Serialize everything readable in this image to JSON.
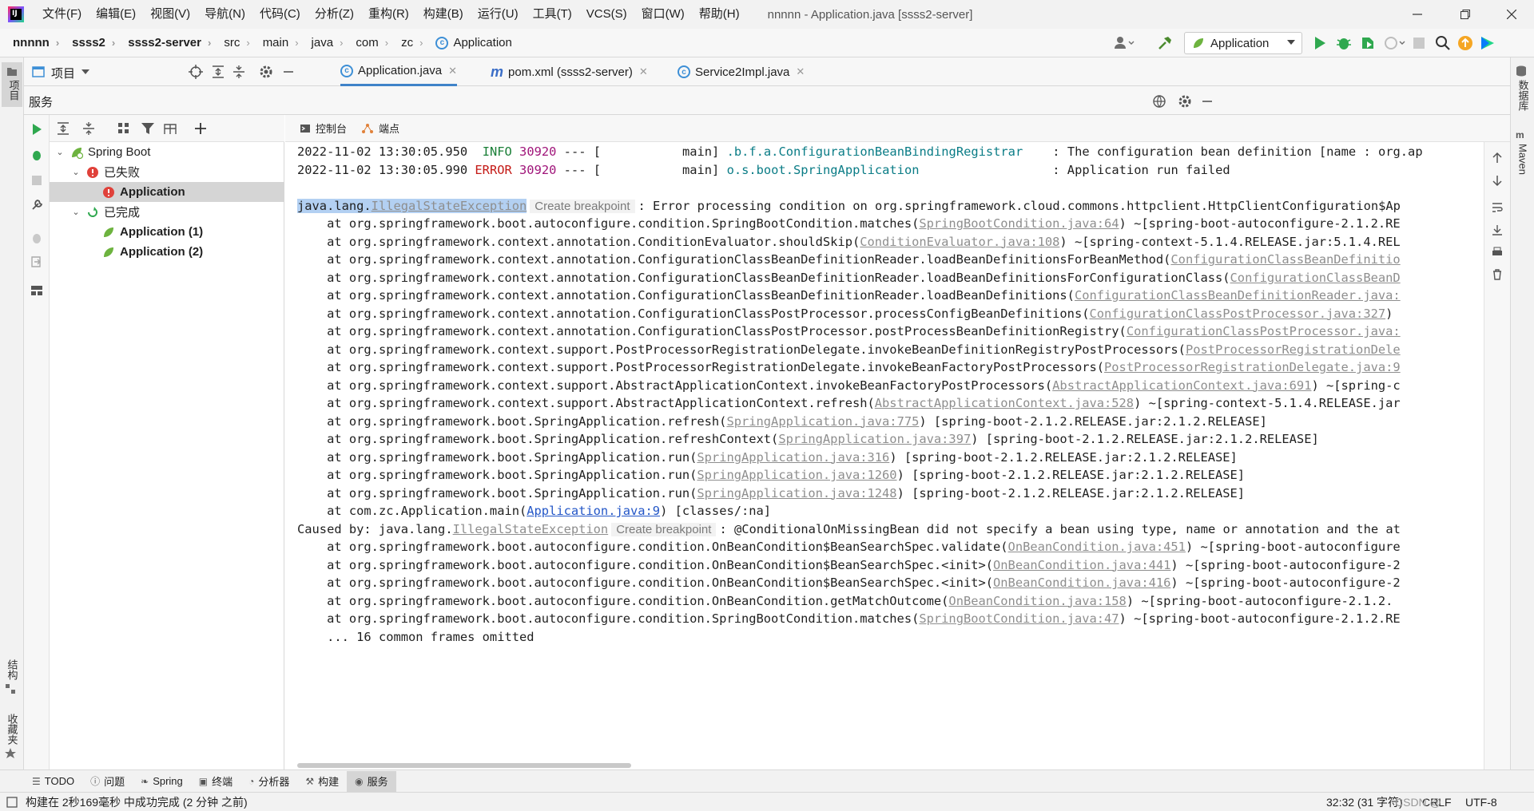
{
  "menu": {
    "items": [
      "文件(F)",
      "编辑(E)",
      "视图(V)",
      "导航(N)",
      "代码(C)",
      "分析(Z)",
      "重构(R)",
      "构建(B)",
      "运行(U)",
      "工具(T)",
      "VCS(S)",
      "窗口(W)",
      "帮助(H)"
    ],
    "window_title": "nnnnn - Application.java [ssss2-server]"
  },
  "breadcrumbs": [
    "nnnnn",
    "ssss2",
    "ssss2-server",
    "src",
    "main",
    "java",
    "com",
    "zc",
    "Application"
  ],
  "run_config": {
    "label": "Application"
  },
  "left_strip": {
    "project": "项目",
    "structure": "结构",
    "favorites": "收藏夹"
  },
  "right_strip": {
    "database": "数据库",
    "maven": "Maven"
  },
  "project_panel": {
    "label": "项目"
  },
  "editor_tabs": [
    {
      "label": "Application.java",
      "icon": "class-icon",
      "active": true
    },
    {
      "label": "pom.xml (ssss2-server)",
      "icon": "maven-icon",
      "active": false
    },
    {
      "label": "Service2Impl.java",
      "icon": "class-icon",
      "active": false
    }
  ],
  "services": {
    "title": "服务",
    "tree": {
      "root": "Spring Boot",
      "failed_group": "已失败",
      "failed_items": [
        "Application"
      ],
      "done_group": "已完成",
      "done_items": [
        "Application (1)",
        "Application (2)"
      ]
    },
    "console_tabs": [
      "控制台",
      "端点"
    ]
  },
  "console": {
    "log_lines": [
      {
        "ts": "2022-11-02 13:30:05.950",
        "level": "INFO",
        "pid": "30920",
        "sep": "--- [",
        "thread": "main]",
        "logger": ".b.f.a.ConfigurationBeanBindingRegistrar",
        "msg": ": The configuration bean definition [name : org.ap"
      },
      {
        "ts": "2022-11-02 13:30:05.990",
        "level": "ERROR",
        "pid": "30920",
        "sep": "--- [",
        "thread": "main]",
        "logger": "o.s.boot.SpringApplication",
        "msg": ": Application run failed"
      }
    ],
    "exception": {
      "pkg": "java.lang.",
      "name": "IllegalStateException",
      "hint": "Create breakpoint",
      "msg": ": Error processing condition on org.springframework.cloud.commons.httpclient.HttpClientConfiguration$Ap"
    },
    "frames": [
      {
        "pre": "at org.springframework.boot.autoconfigure.condition.SpringBootCondition.matches(",
        "link": "SpringBootCondition.java:64",
        "post": ") ~[spring-boot-autoconfigure-2.1.2.RE"
      },
      {
        "pre": "at org.springframework.context.annotation.ConditionEvaluator.shouldSkip(",
        "link": "ConditionEvaluator.java:108",
        "post": ") ~[spring-context-5.1.4.RELEASE.jar:5.1.4.REL"
      },
      {
        "pre": "at org.springframework.context.annotation.ConfigurationClassBeanDefinitionReader.loadBeanDefinitionsForBeanMethod(",
        "link": "ConfigurationClassBeanDefinitio",
        "post": ""
      },
      {
        "pre": "at org.springframework.context.annotation.ConfigurationClassBeanDefinitionReader.loadBeanDefinitionsForConfigurationClass(",
        "link": "ConfigurationClassBeanD",
        "post": ""
      },
      {
        "pre": "at org.springframework.context.annotation.ConfigurationClassBeanDefinitionReader.loadBeanDefinitions(",
        "link": "ConfigurationClassBeanDefinitionReader.java:",
        "post": ""
      },
      {
        "pre": "at org.springframework.context.annotation.ConfigurationClassPostProcessor.processConfigBeanDefinitions(",
        "link": "ConfigurationClassPostProcessor.java:327",
        "post": ")"
      },
      {
        "pre": "at org.springframework.context.annotation.ConfigurationClassPostProcessor.postProcessBeanDefinitionRegistry(",
        "link": "ConfigurationClassPostProcessor.java:",
        "post": ""
      },
      {
        "pre": "at org.springframework.context.support.PostProcessorRegistrationDelegate.invokeBeanDefinitionRegistryPostProcessors(",
        "link": "PostProcessorRegistrationDele",
        "post": ""
      },
      {
        "pre": "at org.springframework.context.support.PostProcessorRegistrationDelegate.invokeBeanFactoryPostProcessors(",
        "link": "PostProcessorRegistrationDelegate.java:9",
        "post": ""
      },
      {
        "pre": "at org.springframework.context.support.AbstractApplicationContext.invokeBeanFactoryPostProcessors(",
        "link": "AbstractApplicationContext.java:691",
        "post": ") ~[spring-c"
      },
      {
        "pre": "at org.springframework.context.support.AbstractApplicationContext.refresh(",
        "link": "AbstractApplicationContext.java:528",
        "post": ") ~[spring-context-5.1.4.RELEASE.jar"
      },
      {
        "pre": "at org.springframework.boot.SpringApplication.refresh(",
        "link": "SpringApplication.java:775",
        "post": ") [spring-boot-2.1.2.RELEASE.jar:2.1.2.RELEASE]"
      },
      {
        "pre": "at org.springframework.boot.SpringApplication.refreshContext(",
        "link": "SpringApplication.java:397",
        "post": ") [spring-boot-2.1.2.RELEASE.jar:2.1.2.RELEASE]"
      },
      {
        "pre": "at org.springframework.boot.SpringApplication.run(",
        "link": "SpringApplication.java:316",
        "post": ") [spring-boot-2.1.2.RELEASE.jar:2.1.2.RELEASE]"
      },
      {
        "pre": "at org.springframework.boot.SpringApplication.run(",
        "link": "SpringApplication.java:1260",
        "post": ") [spring-boot-2.1.2.RELEASE.jar:2.1.2.RELEASE]"
      },
      {
        "pre": "at org.springframework.boot.SpringApplication.run(",
        "link": "SpringApplication.java:1248",
        "post": ") [spring-boot-2.1.2.RELEASE.jar:2.1.2.RELEASE]"
      },
      {
        "pre": "at com.zc.Application.main(",
        "link": "Application.java:9",
        "post": ") [classes/:na]",
        "blue": true
      }
    ],
    "caused_by": {
      "prefix": "Caused by: java.lang.",
      "name": "IllegalStateException",
      "hint": "Create breakpoint",
      "msg": ": @ConditionalOnMissingBean did not specify a bean using type, name or annotation and the at"
    },
    "caused_frames": [
      {
        "pre": "at org.springframework.boot.autoconfigure.condition.OnBeanCondition$BeanSearchSpec.validate(",
        "link": "OnBeanCondition.java:451",
        "post": ") ~[spring-boot-autoconfigure"
      },
      {
        "pre": "at org.springframework.boot.autoconfigure.condition.OnBeanCondition$BeanSearchSpec.<init>(",
        "link": "OnBeanCondition.java:441",
        "post": ") ~[spring-boot-autoconfigure-2"
      },
      {
        "pre": "at org.springframework.boot.autoconfigure.condition.OnBeanCondition$BeanSearchSpec.<init>(",
        "link": "OnBeanCondition.java:416",
        "post": ") ~[spring-boot-autoconfigure-2"
      },
      {
        "pre": "at org.springframework.boot.autoconfigure.condition.OnBeanCondition.getMatchOutcome(",
        "link": "OnBeanCondition.java:158",
        "post": ") ~[spring-boot-autoconfigure-2.1.2."
      },
      {
        "pre": "at org.springframework.boot.autoconfigure.condition.SpringBootCondition.matches(",
        "link": "SpringBootCondition.java:47",
        "post": ") ~[spring-boot-autoconfigure-2.1.2.RE"
      }
    ],
    "omitted": "... 16 common frames omitted"
  },
  "bottom_tabs": [
    {
      "label": "TODO",
      "icon": "list-icon"
    },
    {
      "label": "问题",
      "icon": "problems-icon"
    },
    {
      "label": "Spring",
      "icon": "spring-icon"
    },
    {
      "label": "终端",
      "icon": "terminal-icon"
    },
    {
      "label": "分析器",
      "icon": "profiler-icon"
    },
    {
      "label": "构建",
      "icon": "hammer-icon"
    },
    {
      "label": "服务",
      "icon": "services-icon",
      "active": true
    }
  ],
  "status": {
    "message": "构建在 2秒169毫秒 中成功完成 (2 分钟 之前)",
    "position": "32:32 (31 字符)",
    "line_sep": "CRLF",
    "encoding": "UTF-8",
    "watermark": "CSDN @"
  },
  "colors": {
    "accent": "#4083c9",
    "error": "#c41a16",
    "info": "#1a7f37",
    "run_green": "#2fa84f"
  }
}
